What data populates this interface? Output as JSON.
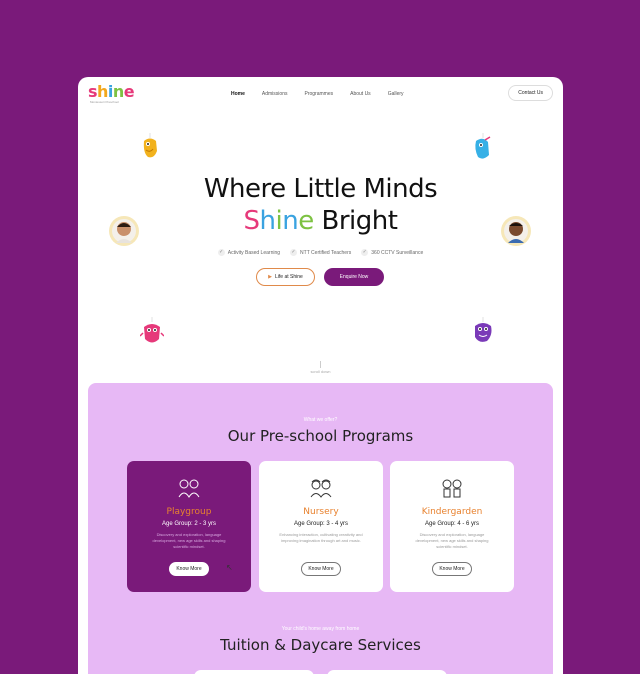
{
  "brand": {
    "logo_letters": [
      "s",
      "h",
      "i",
      "n",
      "e"
    ],
    "logo_colors": [
      "#e6397a",
      "#f2a81d",
      "#3aa3e0",
      "#7dc242",
      "#e6397a"
    ],
    "tagline": "Montessori Preschool"
  },
  "nav": {
    "links": [
      "Home",
      "Admissions",
      "Programmes",
      "About Us",
      "Gallery"
    ],
    "active": "Home",
    "contact_label": "Contact Us"
  },
  "hero": {
    "title_line1": "Where Little Minds",
    "title_shine_letters": [
      "S",
      "h",
      "i",
      "n",
      "e"
    ],
    "title_shine_colors": [
      "#e6397a",
      "#3aa3e0",
      "#7dc242",
      "#3aa3e0",
      "#7dc242"
    ],
    "title_bright": " Bright",
    "features": [
      "Activity Based Learning",
      "NTT Certified Teachers",
      "360 CCTV Surveillance"
    ],
    "life_button": "Life at Shine",
    "enquire_button": "Enquire Now",
    "scroll_label": "scroll down"
  },
  "programs": {
    "kicker": "What we offer?",
    "title": "Our Pre-school Programs",
    "cards": [
      {
        "name": "Playgroup",
        "age": "Age Group: 2 - 3 yrs",
        "desc": "Discovery and exploration, language development, new age skills and shaping scientific mindset.",
        "button": "Know More"
      },
      {
        "name": "Nursery",
        "age": "Age Group: 3 - 4 yrs",
        "desc": "Enhancing interaction, cultivating creativity and improving imagination through art and music.",
        "button": "Know More"
      },
      {
        "name": "Kindergarden",
        "age": "Age Group: 4 - 6 yrs",
        "desc": "Discovery and exploration, language development, new age skills and shaping scientific mindset.",
        "button": "Know More"
      }
    ]
  },
  "daycare": {
    "kicker": "Your child's home away from home",
    "title": "Tuition & Daycare Services"
  },
  "colors": {
    "background": "#7a1a7a",
    "accent_orange": "#e8822f",
    "section_bg": "#e7b8f5"
  }
}
